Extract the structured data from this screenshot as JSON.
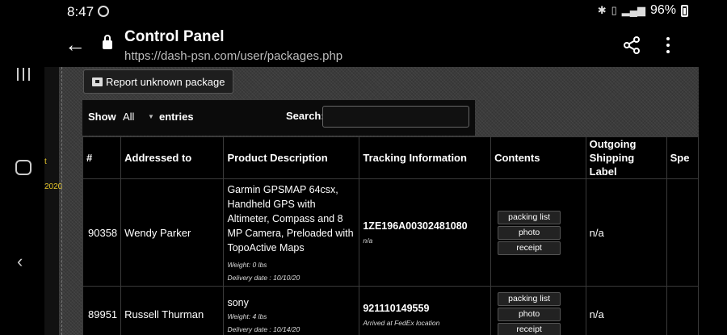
{
  "status_bar": {
    "time": "8:47",
    "battery": "96%"
  },
  "browser": {
    "title": "Control Panel",
    "url": "https://dash-psn.com/user/packages.php"
  },
  "side_strip": {
    "text1": "t",
    "text2": "2020"
  },
  "toolbar": {
    "report_label": "Report unknown package"
  },
  "controls": {
    "show_label": "Show",
    "entries_value": "All",
    "entries_label": "entries",
    "search_label": "Search:"
  },
  "table": {
    "headers": [
      "#",
      "Addressed to",
      "Product Description",
      "Tracking Information",
      "Contents",
      "Outgoing Shipping Label",
      "Spe"
    ],
    "rows": [
      {
        "id": "90358",
        "addressed_to": "Wendy Parker",
        "description": "Garmin GPSMAP 64csx, Handheld GPS with Altimeter, Compass and 8 MP Camera, Preloaded with TopoActive Maps",
        "weight": "Weight: 0 lbs",
        "delivery": "Delivery date : 10/10/20",
        "tracking": "1ZE196A00302481080",
        "tracking_status": "n/a",
        "contents": [
          "packing list",
          "photo",
          "receipt"
        ],
        "label": "n/a"
      },
      {
        "id": "89951",
        "addressed_to": "Russell Thurman",
        "description": "sony",
        "weight": "Weight: 4 lbs",
        "delivery": "Delivery date : 10/14/20",
        "tracking": "921110149559",
        "tracking_status": "Arrived at FedEx location",
        "contents": [
          "packing list",
          "photo",
          "receipt"
        ],
        "label": "n/a"
      }
    ]
  }
}
